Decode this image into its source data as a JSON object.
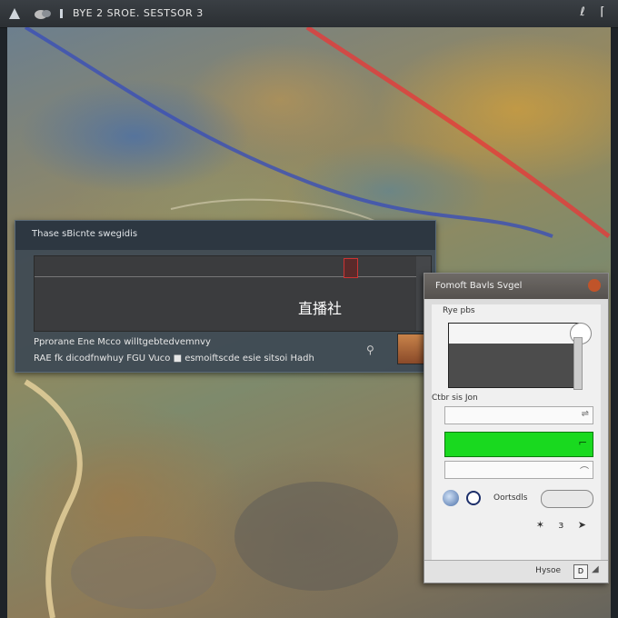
{
  "app": {
    "title": "BYE 2 SROE. SESTSOR 3"
  },
  "left_panel": {
    "title": "Thase sBicnte swegidis",
    "video_text": "直播社",
    "line1": "Pprorane Ene Mcco willtgebtedvemnvy",
    "line2": "RAE fk dicodfnwhuy FGU Vuco ■ esmoiftscde esie sitsoi Hadh"
  },
  "right_panel": {
    "title": "Fomoft Bavls Svgel",
    "label1": "Rye pbs",
    "label2": "Ctbr sis Jon",
    "orient_label": "Oortsdls",
    "arrows": "✶ ɜ ➤",
    "footer_label": "Hysoe"
  },
  "colors": {
    "accent_green": "#19d91f",
    "dialog_header": "#6e6a66",
    "close": "#c0542a"
  },
  "icons": [
    "app-logo-icon",
    "cloud-icon",
    "dropdown-icon",
    "minimize-icon",
    "maximize-icon",
    "close-icon"
  ]
}
